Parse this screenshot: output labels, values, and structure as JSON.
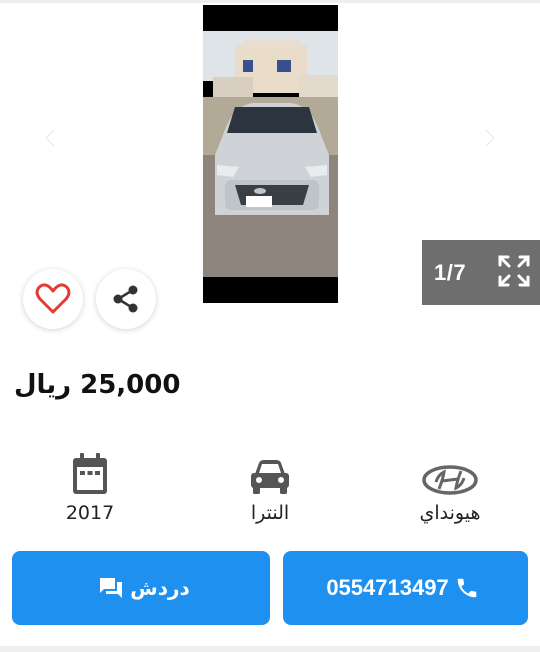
{
  "gallery": {
    "counter": "1/7",
    "prev_icon": "chevron-left-icon",
    "next_icon": "chevron-right-icon",
    "expand_icon": "fullscreen-icon"
  },
  "actions": {
    "favorite_icon": "heart-outline-icon",
    "share_icon": "share-icon"
  },
  "listing": {
    "price": "25,000 ريال",
    "specs": {
      "year": "2017",
      "model": "النترا",
      "make": "هيونداي"
    }
  },
  "buttons": {
    "chat_label": "دردش",
    "phone_label": "0554713497"
  },
  "colors": {
    "primary": "#1e90f0",
    "heart": "#e53935",
    "counter_bg": "#6e6e6e"
  }
}
